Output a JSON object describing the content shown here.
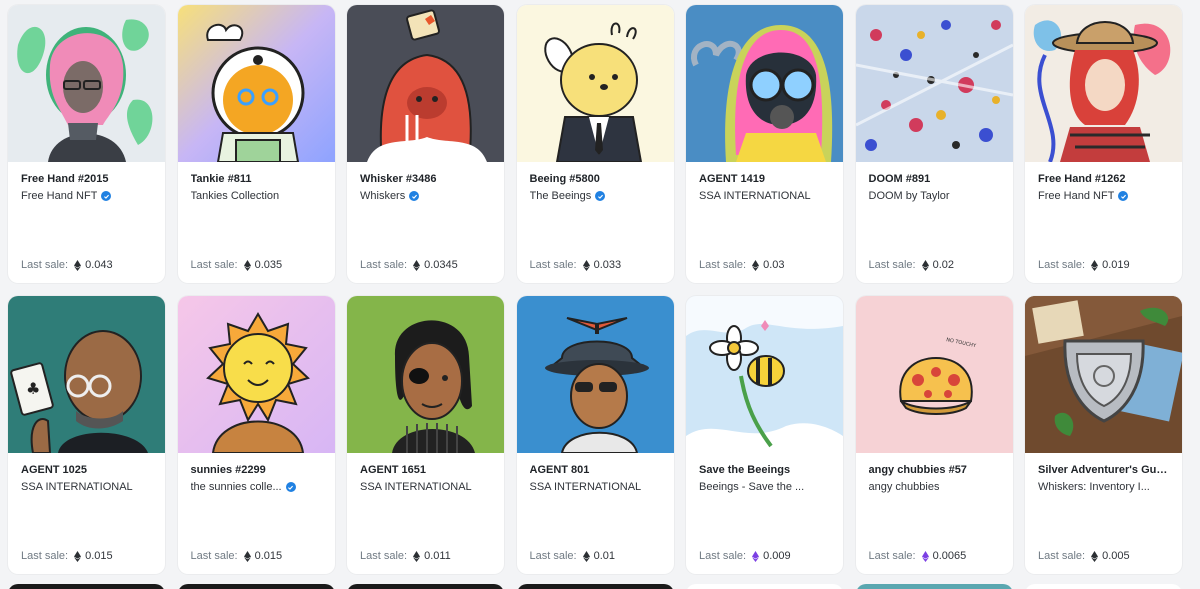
{
  "cards": [
    {
      "title": "Free Hand #2015",
      "collection": "Free Hand NFT",
      "verified": true,
      "sale_label": "Last sale:",
      "price": "0.043",
      "currency": "eth",
      "art": "freehand"
    },
    {
      "title": "Tankie #811",
      "collection": "Tankies Collection",
      "verified": false,
      "sale_label": "Last sale:",
      "price": "0.035",
      "currency": "eth",
      "art": "tankie"
    },
    {
      "title": "Whisker #3486",
      "collection": "Whiskers",
      "verified": true,
      "sale_label": "Last sale:",
      "price": "0.0345",
      "currency": "eth",
      "art": "whisker"
    },
    {
      "title": "Beeing #5800",
      "collection": "The Beeings",
      "verified": true,
      "sale_label": "Last sale:",
      "price": "0.033",
      "currency": "eth",
      "art": "beeing"
    },
    {
      "title": "AGENT 1419",
      "collection": "SSA INTERNATIONAL",
      "verified": false,
      "sale_label": "Last sale:",
      "price": "0.03",
      "currency": "eth",
      "art": "agent_mask"
    },
    {
      "title": "DOOM #891",
      "collection": "DOOM by Taylor",
      "verified": false,
      "sale_label": "Last sale:",
      "price": "0.02",
      "currency": "eth",
      "art": "doom"
    },
    {
      "title": "Free Hand #1262",
      "collection": "Free Hand NFT",
      "verified": true,
      "sale_label": "Last sale:",
      "price": "0.019",
      "currency": "eth",
      "art": "freehand2"
    },
    {
      "title": "AGENT 1025",
      "collection": "SSA INTERNATIONAL",
      "verified": false,
      "sale_label": "Last sale:",
      "price": "0.015",
      "currency": "eth",
      "art": "agent_bald"
    },
    {
      "title": "sunnies #2299",
      "collection": "the sunnies colle...",
      "verified": true,
      "sale_label": "Last sale:",
      "price": "0.015",
      "currency": "eth",
      "art": "sunnies"
    },
    {
      "title": "AGENT 1651",
      "collection": "SSA INTERNATIONAL",
      "verified": false,
      "sale_label": "Last sale:",
      "price": "0.011",
      "currency": "eth",
      "art": "agent_patch"
    },
    {
      "title": "AGENT 801",
      "collection": "SSA INTERNATIONAL",
      "verified": false,
      "sale_label": "Last sale:",
      "price": "0.01",
      "currency": "eth",
      "art": "agent_hat"
    },
    {
      "title": "Save the Beeings",
      "collection": "Beeings - Save the ...",
      "verified": false,
      "sale_label": "Last sale:",
      "price": "0.009",
      "currency": "weth",
      "art": "savebee"
    },
    {
      "title": "angy chubbies #57",
      "collection": "angy chubbies",
      "verified": false,
      "sale_label": "Last sale:",
      "price": "0.0065",
      "currency": "weth",
      "art": "chubby"
    },
    {
      "title": "Silver Adventurer's Guild ...",
      "collection": "Whiskers: Inventory I...",
      "verified": false,
      "sale_label": "Last sale:",
      "price": "0.005",
      "currency": "eth",
      "art": "guild"
    }
  ],
  "colors": {
    "eth": "#2b2f33",
    "weth": "#7b3fe4",
    "verified": "#2081e2",
    "stub_row": [
      "#1a1a1a",
      "#1a1a1a",
      "#1a1a1a",
      "#1a1a1a",
      "#ffffff",
      "#5aa7b0",
      "#ffffff"
    ]
  },
  "art_text": {
    "chubby_note": "NO TOUCHY"
  }
}
